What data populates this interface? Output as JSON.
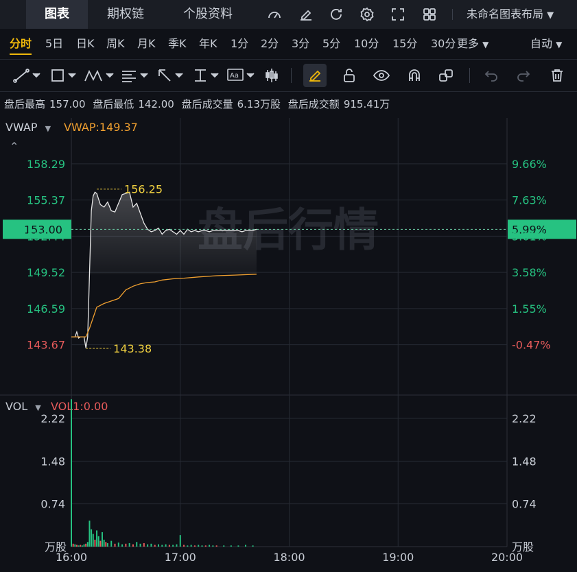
{
  "top_tabs": [
    "图表",
    "期权链",
    "个股资料"
  ],
  "top_icons": [
    "gauge-icon",
    "edit-icon",
    "refresh-icon",
    "settings-icon",
    "fullscreen-icon",
    "grid-icon"
  ],
  "layout_label": "未命名图表布局",
  "periods": [
    "分时",
    "5日",
    "日K",
    "周K",
    "月K",
    "季K",
    "年K",
    "1分",
    "2分",
    "3分",
    "5分",
    "10分",
    "15分",
    "30分",
    "更多"
  ],
  "period_more_label": "更多",
  "auto_label": "自动",
  "info": {
    "high_label": "盘后最高",
    "high": "157.00",
    "low_label": "盘后最低",
    "low": "142.00",
    "vol_label": "盘后成交量",
    "vol": "6.13万股",
    "amt_label": "盘后成交额",
    "amt": "915.41万"
  },
  "watermark": "盘后行情",
  "main_indicator": {
    "name": "VWAP",
    "value_label": "VWAP:149.37"
  },
  "vol_indicator": {
    "name": "VOL",
    "value_label": "VOL1:0.00"
  },
  "colors": {
    "up": "#26c281",
    "down": "#e85b5b",
    "price_line": "#e6e6e6",
    "vwap": "#f0a030",
    "marker": "#f0d040",
    "bg": "#0f1117",
    "grid": "#262a33"
  },
  "chart_data": {
    "type": "line",
    "x_ticks": [
      "16:00",
      "17:00",
      "18:00",
      "19:00",
      "20:00"
    ],
    "x_range_minutes": [
      0,
      240
    ],
    "y_ticks": [
      "158.29",
      "155.37",
      "152.44",
      "149.52",
      "146.59",
      "143.67"
    ],
    "y_ticks_pct": [
      "9.66%",
      "7.63%",
      "5.61%",
      "3.58%",
      "1.55%",
      "-0.47%"
    ],
    "y_range": [
      142.2,
      160.0
    ],
    "prev_close": 144.34,
    "current_price": "153.00",
    "current_pct": "5.99%",
    "max_marker": {
      "label": "156.25",
      "value": 156.25,
      "minute": 14
    },
    "min_marker": {
      "label": "143.38",
      "value": 143.38,
      "minute": 8
    },
    "price_series": {
      "minutes": [
        0,
        2,
        3,
        4,
        5,
        7,
        8,
        9,
        10,
        11,
        12,
        13,
        14,
        16,
        18,
        20,
        22,
        24,
        26,
        28,
        30,
        32,
        34,
        36,
        38,
        40,
        42,
        44,
        46,
        48,
        50,
        52,
        54,
        56,
        58,
        60,
        62,
        64,
        66,
        68,
        70,
        72,
        74,
        76,
        78,
        80,
        82,
        84,
        86,
        88,
        90,
        92,
        94,
        96,
        98,
        100,
        102
      ],
      "values": [
        144.3,
        144.3,
        144.7,
        144.2,
        144.3,
        144.3,
        143.4,
        144.3,
        149.5,
        154.5,
        155.7,
        156.0,
        155.9,
        155.0,
        154.8,
        155.2,
        154.5,
        154.4,
        155.1,
        155.8,
        155.9,
        156.0,
        154.8,
        155.1,
        154.3,
        153.5,
        153.0,
        152.8,
        152.9,
        153.1,
        152.6,
        152.9,
        153.0,
        152.8,
        152.6,
        152.9,
        152.6,
        153.0,
        152.8,
        152.9,
        152.8,
        152.9,
        152.9,
        152.8,
        152.9,
        152.9,
        152.9,
        152.9,
        152.9,
        152.9,
        152.9,
        152.9,
        152.8,
        152.9,
        152.9,
        152.9,
        153.0
      ]
    },
    "vwap_series": {
      "minutes": [
        0,
        8,
        10,
        14,
        18,
        22,
        26,
        30,
        34,
        38,
        42,
        46,
        50,
        56,
        62,
        70,
        80,
        90,
        102
      ],
      "values": [
        144.3,
        144.3,
        145.0,
        146.7,
        147.0,
        147.2,
        147.4,
        148.1,
        148.4,
        148.6,
        148.7,
        148.75,
        148.9,
        149.0,
        149.05,
        149.15,
        149.25,
        149.3,
        149.37
      ]
    },
    "volume": {
      "unit_label": "万股",
      "y_ticks": [
        "2.22",
        "1.48",
        "0.74"
      ],
      "y_range": [
        0,
        2.6
      ],
      "minutes": [
        0,
        1,
        2,
        3,
        4,
        5,
        6,
        7,
        8,
        9,
        10,
        11,
        12,
        13,
        14,
        15,
        16,
        17,
        18,
        19,
        20,
        22,
        24,
        26,
        28,
        30,
        32,
        34,
        36,
        38,
        40,
        42,
        44,
        46,
        48,
        50,
        52,
        54,
        56,
        58,
        60,
        62,
        64,
        66,
        68,
        70,
        72,
        74,
        76,
        78,
        80,
        84,
        88,
        92,
        96,
        100
      ],
      "values": [
        2.55,
        0.05,
        0.04,
        0.03,
        0.02,
        0.03,
        0.02,
        0.04,
        0.05,
        0.08,
        0.45,
        0.3,
        0.22,
        0.12,
        0.28,
        0.18,
        0.1,
        0.25,
        0.12,
        0.08,
        0.06,
        0.1,
        0.05,
        0.07,
        0.04,
        0.05,
        0.06,
        0.04,
        0.08,
        0.05,
        0.06,
        0.04,
        0.05,
        0.03,
        0.04,
        0.03,
        0.04,
        0.03,
        0.03,
        0.04,
        0.2,
        0.03,
        0.02,
        0.03,
        0.02,
        0.03,
        0.02,
        0.02,
        0.03,
        0.02,
        0.02,
        0.02,
        0.02,
        0.02,
        0.03,
        0.02
      ],
      "up": [
        true,
        false,
        true,
        false,
        true,
        false,
        true,
        true,
        false,
        true,
        true,
        true,
        true,
        false,
        true,
        true,
        false,
        true,
        true,
        false,
        true,
        true,
        false,
        true,
        true,
        false,
        true,
        false,
        true,
        true,
        false,
        true,
        true,
        false,
        true,
        true,
        true,
        false,
        true,
        true,
        true,
        false,
        true,
        true,
        false,
        true,
        true,
        false,
        true,
        true,
        false,
        true,
        true,
        true,
        true,
        true
      ]
    }
  }
}
